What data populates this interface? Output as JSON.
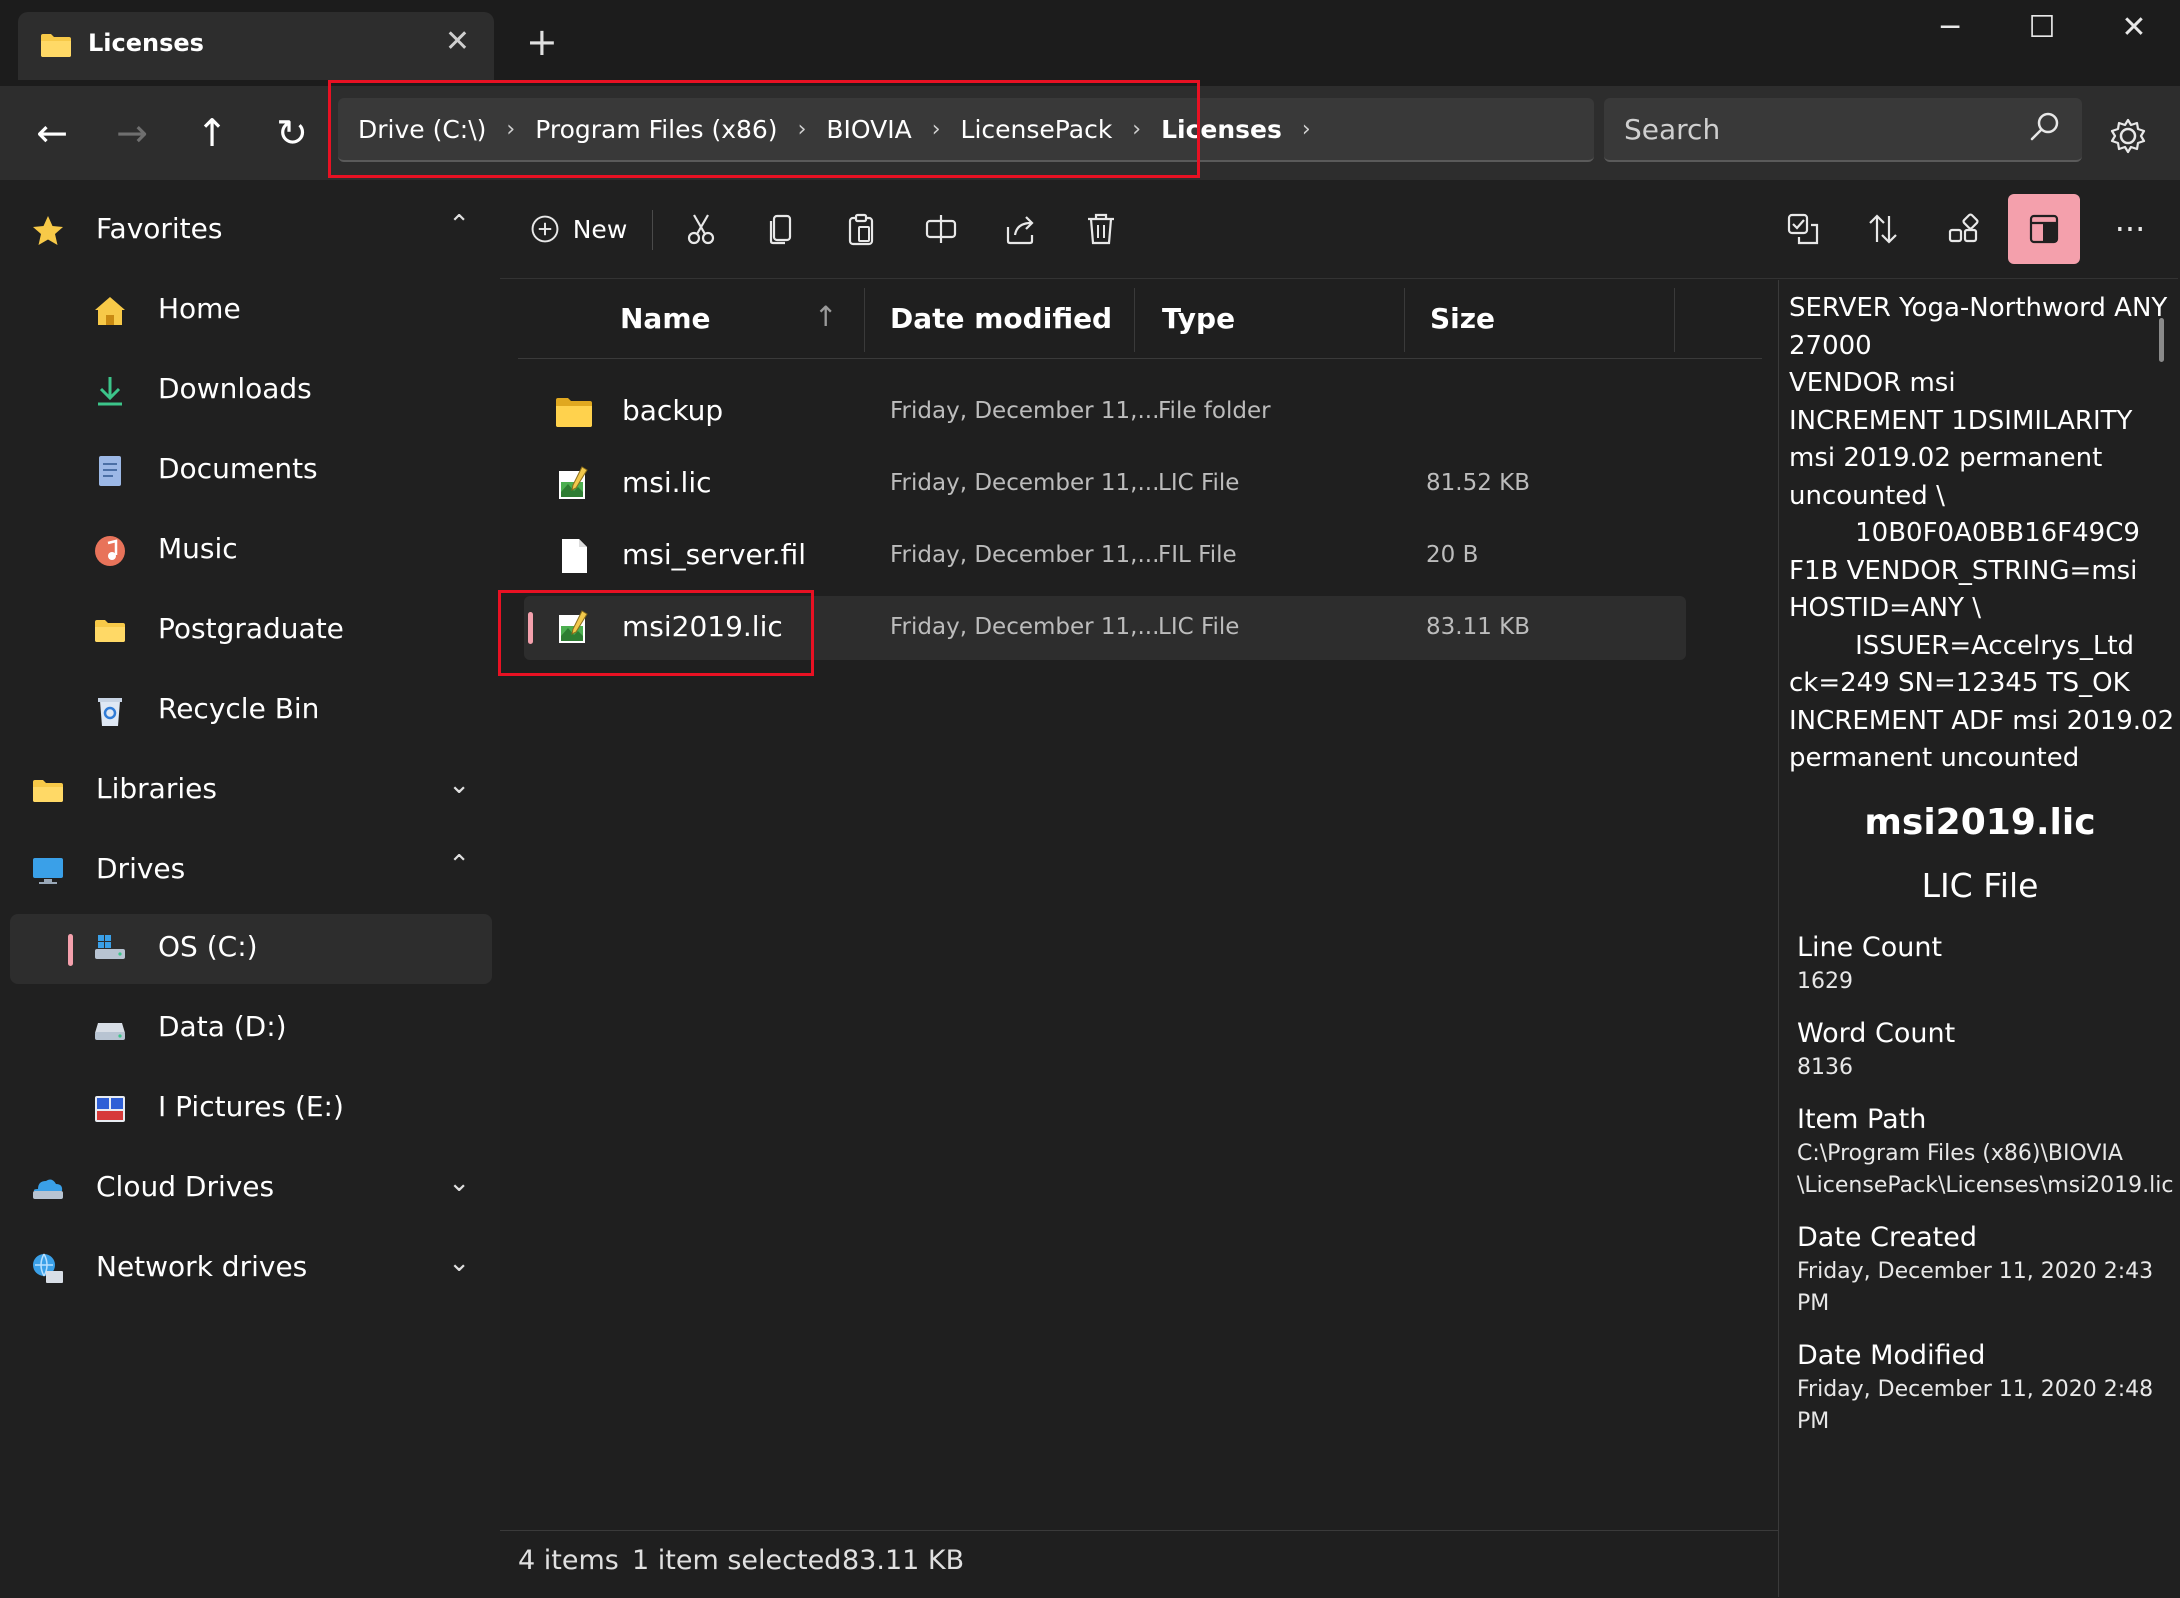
{
  "window": {
    "tab_title": "Licenses",
    "tab_close": "✕",
    "new_tab": "+",
    "minimize": "─",
    "maximize": "☐",
    "close": "✕"
  },
  "nav": {
    "back": "←",
    "forward": "→",
    "up": "↑",
    "refresh": "↻"
  },
  "breadcrumb": {
    "items": [
      "Drive (C:\\)",
      "Program Files (x86)",
      "BIOVIA",
      "LicensePack",
      "Licenses"
    ],
    "separator": "›"
  },
  "search": {
    "placeholder": "Search"
  },
  "sidebar": {
    "favorites": "Favorites",
    "home": "Home",
    "downloads": "Downloads",
    "documents": "Documents",
    "music": "Music",
    "postgraduate": "Postgraduate",
    "recycle_bin": "Recycle Bin",
    "libraries": "Libraries",
    "drives": "Drives",
    "os_c": "OS (C:)",
    "data_d": "Data (D:)",
    "pictures_e": "I Pictures (E:)",
    "cloud_drives": "Cloud Drives",
    "network_drives": "Network drives",
    "chev_up": "⌃",
    "chev_down": "⌄",
    "colors": {
      "accent": "#f4a0ac",
      "selected_bg": "#2d2d2d",
      "folder": "#f7c948"
    }
  },
  "toolbar": {
    "new_label": "New",
    "more": "···"
  },
  "columns": {
    "name": "Name",
    "date_modified": "Date modified",
    "type": "Type",
    "size": "Size",
    "sort_arrow": "↑"
  },
  "files": [
    {
      "name": "backup",
      "date": "Friday, December 11,...",
      "type": "File folder",
      "size": "",
      "icon": "folder-icon"
    },
    {
      "name": "msi.lic",
      "date": "Friday, December 11,...",
      "type": "LIC File",
      "size": "81.52 KB",
      "icon": "lic-file-icon"
    },
    {
      "name": "msi_server.fil",
      "date": "Friday, December 11,...",
      "type": "FIL File",
      "size": "20 B",
      "icon": "blank-file-icon"
    },
    {
      "name": "msi2019.lic",
      "date": "Friday, December 11,...",
      "type": "LIC File",
      "size": "83.11 KB",
      "icon": "lic-file-icon",
      "selected": true
    }
  ],
  "status": {
    "items": "4 items",
    "selected": "1 item selected",
    "size": "83.11 KB"
  },
  "preview": {
    "text": "SERVER Yoga-Northword ANY\n27000\nVENDOR msi\nINCREMENT 1DSIMILARITY\nmsi 2019.02 permanent\nuncounted \\\n        10B0F0A0BB16F49C9\nF1B VENDOR_STRING=msi\nHOSTID=ANY \\\n        ISSUER=Accelrys_Ltd\nck=249 SN=12345 TS_OK\nINCREMENT ADF msi 2019.02\npermanent uncounted",
    "file_name": "msi2019.lic",
    "file_type": "LIC File",
    "line_count_label": "Line Count",
    "line_count": "1629",
    "word_count_label": "Word Count",
    "word_count": "8136",
    "item_path_label": "Item Path",
    "item_path_1": "C:\\Program Files (x86)\\BIOVIA",
    "item_path_2": "\\LicensePack\\Licenses\\msi2019.lic",
    "date_created_label": "Date Created",
    "date_created_1": "Friday, December 11, 2020 2:43",
    "date_created_2": "PM",
    "date_modified_label": "Date Modified",
    "date_modified_1": "Friday, December 11, 2020 2:48",
    "date_modified_2": "PM"
  }
}
